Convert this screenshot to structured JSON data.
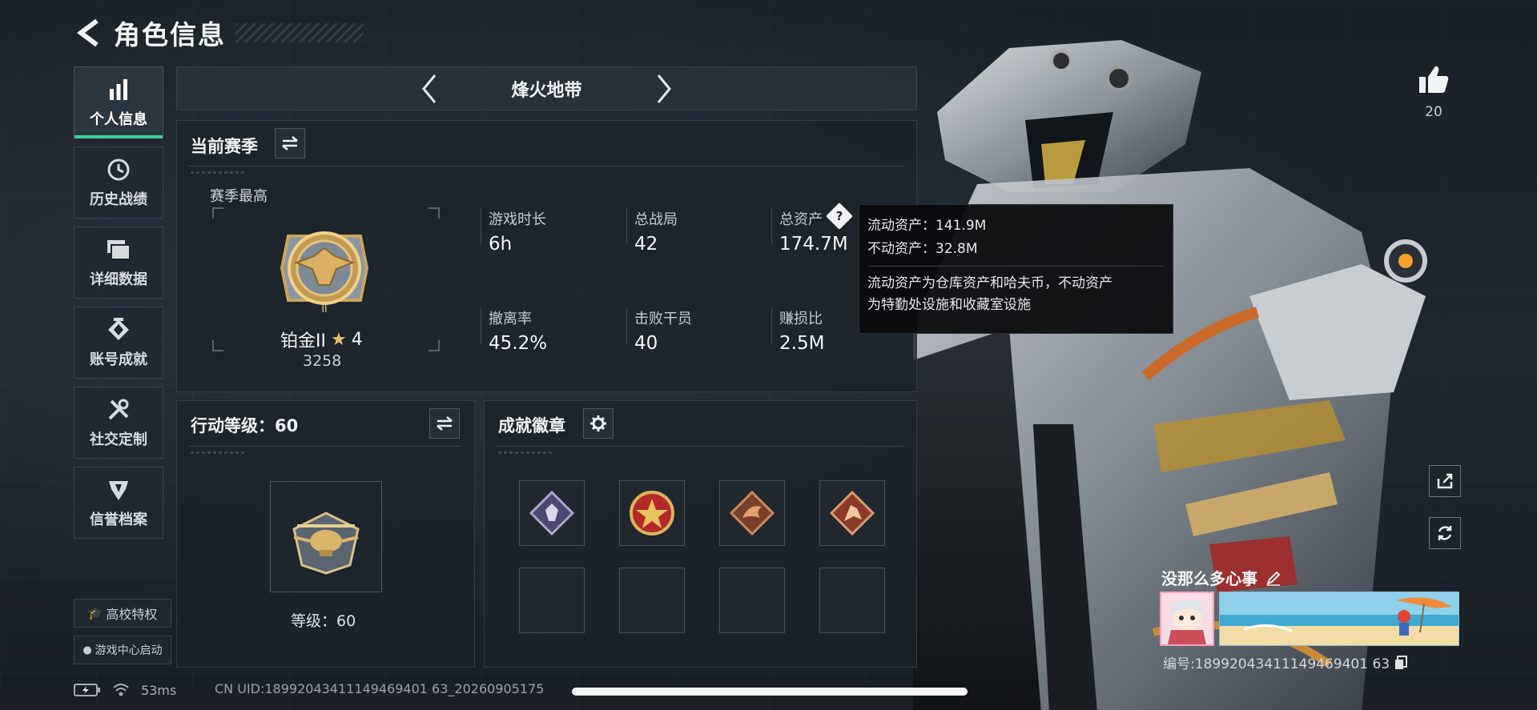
{
  "header": {
    "title": "角色信息"
  },
  "sidebar": {
    "items": [
      {
        "label": "个人信息",
        "icon": "bar-chart-icon"
      },
      {
        "label": "历史战绩",
        "icon": "clock-history-icon"
      },
      {
        "label": "详细数据",
        "icon": "folder-stack-icon"
      },
      {
        "label": "账号成就",
        "icon": "emblem-achievement-icon"
      },
      {
        "label": "社交定制",
        "icon": "tools-customize-icon"
      },
      {
        "label": "信誉档案",
        "icon": "shield-credit-icon"
      }
    ],
    "campus_label": "高校特权",
    "game_center_label": "游戏中心启动"
  },
  "mode_tabs": {
    "current": "烽火地带"
  },
  "season": {
    "title": "当前赛季",
    "best_label": "赛季最高",
    "rank_name": "铂金II",
    "rank_stars": "4",
    "rank_points": "3258",
    "stats": [
      {
        "label": "游戏时长",
        "value": "6h"
      },
      {
        "label": "总战局",
        "value": "42"
      },
      {
        "label": "总资产",
        "value": "174.7M"
      },
      {
        "label": "撤离率",
        "value": "45.2%"
      },
      {
        "label": "击败干员",
        "value": "40"
      },
      {
        "label": "赚损比",
        "value": "2.5M"
      }
    ]
  },
  "tooltip": {
    "liquid": "流动资产：141.9M",
    "fixed": "不动资产：32.8M",
    "note_line1": "流动资产为仓库资产和哈夫币，不动资产",
    "note_line2": "为特勤处设施和收藏室设施"
  },
  "action_level": {
    "title": "行动等级：60",
    "level_text": "等级：60"
  },
  "achievements": {
    "title": "成就徽章",
    "badges": [
      "crystal-badge-icon",
      "star-badge-icon",
      "dragon-badge-icon",
      "warrior-badge-icon"
    ]
  },
  "profile": {
    "likes": "20",
    "nickname": "没那么多心事",
    "uid_label": "编号:18992043411149469401 63"
  },
  "status": {
    "ping": "53ms",
    "uid_full": "CN UID:18992043411149469401 63_20260905175"
  }
}
